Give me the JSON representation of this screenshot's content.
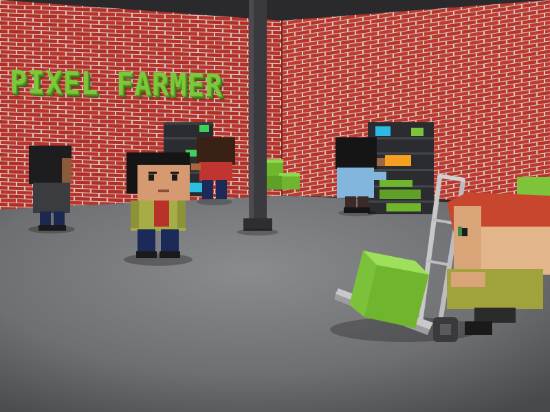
{
  "sign": {
    "text": "PIXEL FARMER"
  },
  "colors": {
    "brick": "#b8342c",
    "mortar": "#d9cfc8",
    "floor": "#7a7b7d",
    "sign_green": "#7dc83a",
    "crate_green": "#7ec43a",
    "pillar": "#3a3a3e"
  },
  "icons": {
    "hand_truck": "hand-truck-icon",
    "crate": "crate-icon",
    "shelf": "shelf-icon"
  }
}
